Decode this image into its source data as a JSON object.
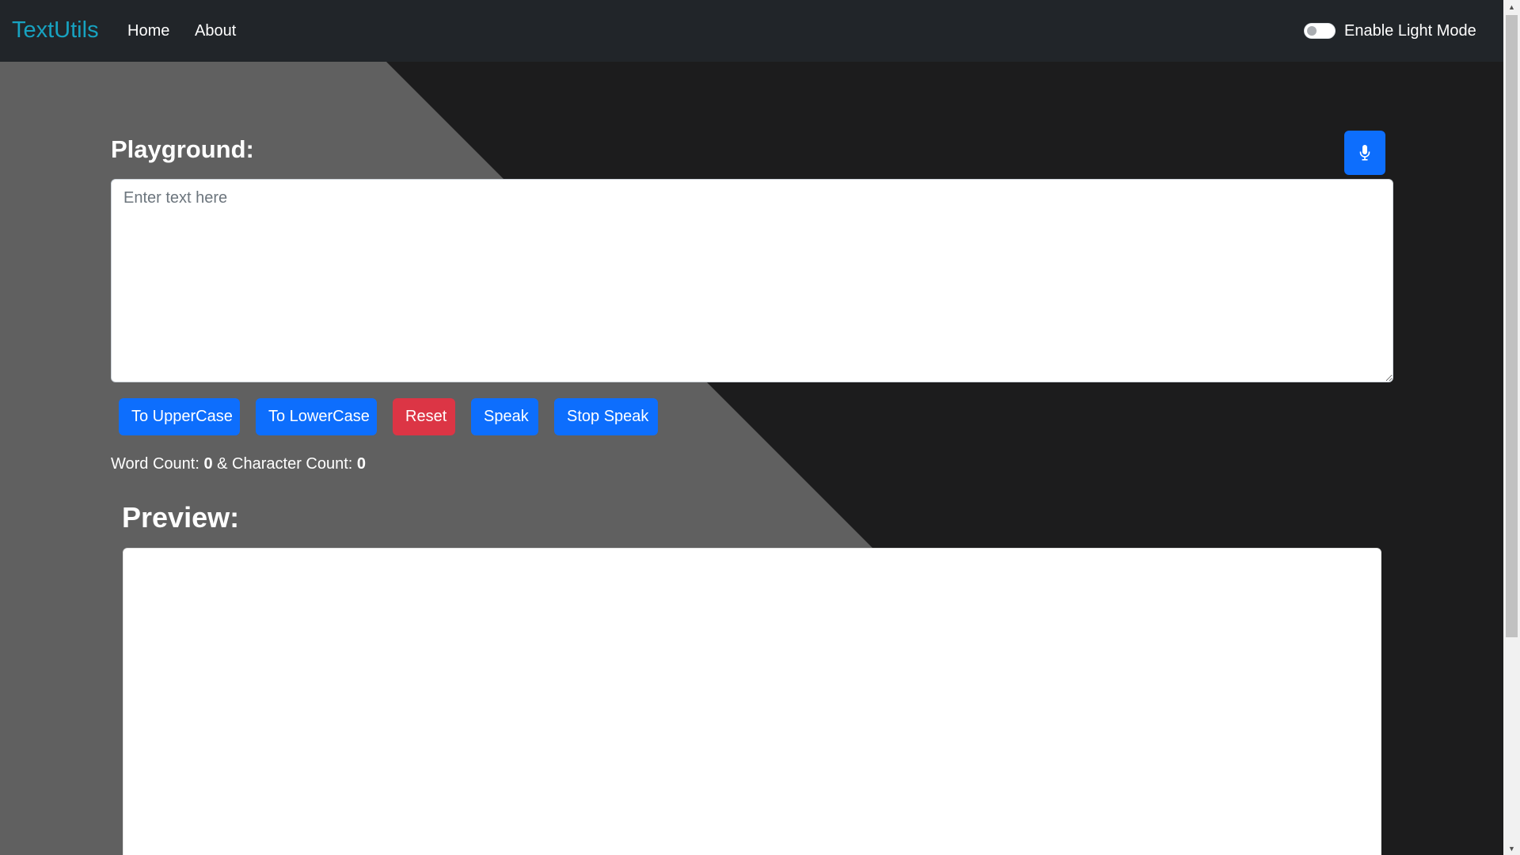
{
  "navbar": {
    "brand": "TextUtils",
    "links": [
      {
        "label": "Home"
      },
      {
        "label": "About"
      }
    ],
    "toggle_label": "Enable Light Mode"
  },
  "playground": {
    "heading": "Playground:",
    "textarea_placeholder": "Enter text here",
    "textarea_value": ""
  },
  "buttons": {
    "uppercase": "To UpperCase",
    "lowercase": "To LowerCase",
    "reset": "Reset",
    "speak": "Speak",
    "stop_speak": "Stop Speak"
  },
  "counts": {
    "word_label": "Word Count: ",
    "word_value": "0",
    "separator": " & Character Count: ",
    "char_value": "0"
  },
  "preview": {
    "heading": "Preview:",
    "content": ""
  },
  "colors": {
    "navbar_bg": "#212529",
    "brand": "#17a2c0",
    "primary": "#0d6efd",
    "danger": "#dc3545",
    "bg_light_panel": "#606060",
    "bg_dark": "#1c1c1d"
  },
  "icons": {
    "mic": "microphone-icon"
  }
}
